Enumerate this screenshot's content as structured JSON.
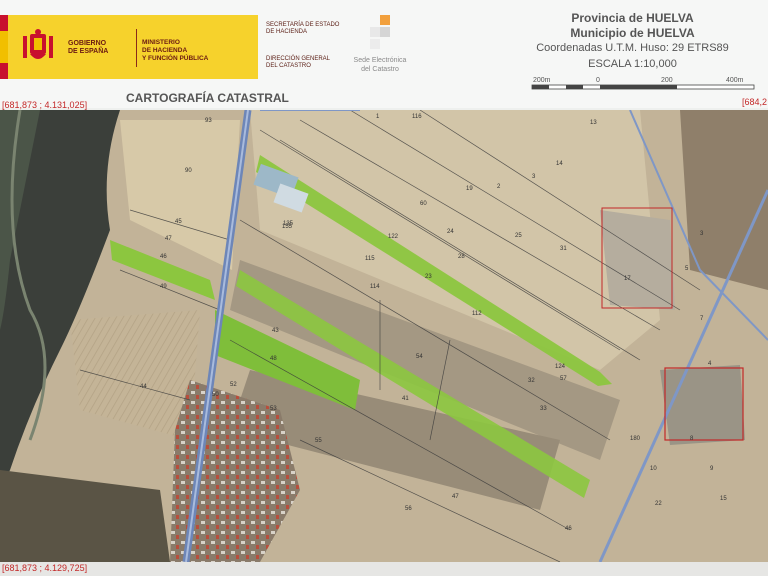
{
  "header": {
    "gov_label": "GOBIERNO\nDE ESPAÑA",
    "ministry_label": "MINISTERIO\nDE HACIENDA\nY FUNCIÓN PÚBLICA",
    "secretaria_label": "SECRETARÍA DE ESTADO\nDE HACIENDA",
    "direccion_label": "DIRECCIÓN GENERAL\nDEL CATASTRO",
    "sede_label": "Sede Electrónica\ndel Catastro",
    "provincia": "Provincia de HUELVA",
    "municipio": "Municipio de HUELVA",
    "coordenadas": "Coordenadas U.T.M. Huso: 29 ETRS89",
    "escala": "ESCALA 1:10,000",
    "scale_ticks": [
      "200m",
      "0",
      "200",
      "400m"
    ],
    "title": "CARTOGRAFÍA CATASTRAL"
  },
  "corners": {
    "top_left": "[681,873 ; 4.131,025]",
    "top_right": "[684,2",
    "bottom_left": "[681,873 ; 4.129,725]"
  },
  "colors": {
    "gov_yellow": "#f6d22c",
    "parcel_green": "#8cc63f",
    "road_blue": "#7f97c6",
    "river_dark": "#3b3f3a",
    "coord_red": "#c32828"
  },
  "map": {
    "parcels": [
      "93",
      "90",
      "45",
      "46",
      "47",
      "48",
      "135",
      "115",
      "122",
      "114",
      "112",
      "54",
      "41",
      "32",
      "33",
      "23",
      "28",
      "25",
      "24",
      "19",
      "2",
      "3",
      "14",
      "13",
      "1",
      "116",
      "155",
      "43",
      "49",
      "44",
      "52",
      "50",
      "53",
      "55",
      "56",
      "47",
      "46",
      "57",
      "124",
      "180",
      "10",
      "17",
      "5",
      "7",
      "4",
      "8",
      "9",
      "15",
      "22",
      "3",
      "60",
      "31"
    ]
  }
}
